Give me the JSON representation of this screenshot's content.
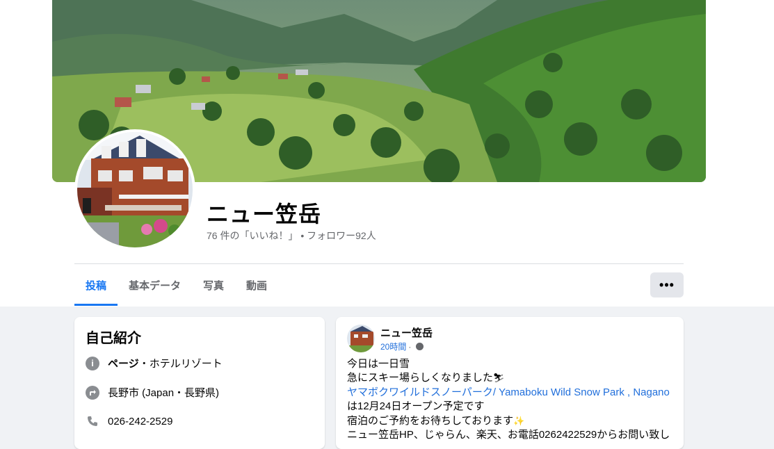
{
  "page": {
    "name": "ニュー笠岳",
    "stats": "76 件の「いいね！」 • フォロワー92人"
  },
  "tabs": [
    {
      "label": "投稿",
      "active": true
    },
    {
      "label": "基本データ",
      "active": false
    },
    {
      "label": "写真",
      "active": false
    },
    {
      "label": "動画",
      "active": false
    }
  ],
  "more_button": "•••",
  "intro": {
    "title": "自己紹介",
    "category_prefix": "ページ",
    "category_suffix": "・ホテルリゾート",
    "location": "長野市 (Japan・長野県)",
    "phone": "026-242-2529",
    "info_icon": "i",
    "location_icon": "directions-icon",
    "phone_icon": "phone-icon"
  },
  "post": {
    "author": "ニュー笠岳",
    "time": "20時間",
    "separator": "·",
    "line1": "今日は一日雪",
    "line2": "急にスキー場らしくなりました",
    "line2_emoji": "⛷",
    "link": "ヤマボクワイルドスノーパーク/ Yamaboku Wild Snow Park , Nagano",
    "line3": "は12月24日オープン予定です",
    "line4": "宿泊のご予約をお待ちしております",
    "line4_emoji": "✨",
    "line5": "ニュー笠岳HP、じゃらん、楽天、お電話0262422529からお問い致し"
  },
  "colors": {
    "accent": "#1877f2",
    "link": "#216fdb",
    "muted": "#65676b",
    "background": "#f0f2f5"
  }
}
